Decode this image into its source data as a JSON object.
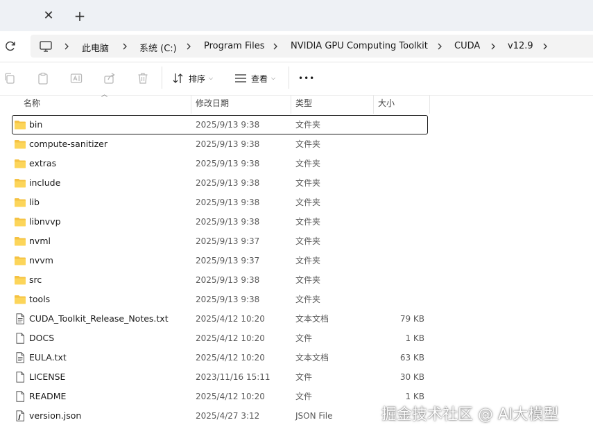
{
  "breadcrumb": [
    "此电脑",
    "系统 (C:)",
    "Program Files",
    "NVIDIA GPU Computing Toolkit",
    "CUDA",
    "v12.9"
  ],
  "toolbar": {
    "sort_label": "排序",
    "view_label": "查看",
    "more_label": "•••"
  },
  "columns": {
    "name": "名称",
    "date": "修改日期",
    "type": "类型",
    "size": "大小"
  },
  "files": [
    {
      "name": "bin",
      "date": "2025/9/13 9:38",
      "type": "文件夹",
      "size": "",
      "icon": "folder-icon",
      "selected": true
    },
    {
      "name": "compute-sanitizer",
      "date": "2025/9/13 9:38",
      "type": "文件夹",
      "size": "",
      "icon": "folder-icon"
    },
    {
      "name": "extras",
      "date": "2025/9/13 9:38",
      "type": "文件夹",
      "size": "",
      "icon": "folder-icon"
    },
    {
      "name": "include",
      "date": "2025/9/13 9:38",
      "type": "文件夹",
      "size": "",
      "icon": "folder-icon"
    },
    {
      "name": "lib",
      "date": "2025/9/13 9:38",
      "type": "文件夹",
      "size": "",
      "icon": "folder-icon"
    },
    {
      "name": "libnvvp",
      "date": "2025/9/13 9:38",
      "type": "文件夹",
      "size": "",
      "icon": "folder-icon"
    },
    {
      "name": "nvml",
      "date": "2025/9/13 9:37",
      "type": "文件夹",
      "size": "",
      "icon": "folder-icon"
    },
    {
      "name": "nvvm",
      "date": "2025/9/13 9:37",
      "type": "文件夹",
      "size": "",
      "icon": "folder-icon"
    },
    {
      "name": "src",
      "date": "2025/9/13 9:38",
      "type": "文件夹",
      "size": "",
      "icon": "folder-icon"
    },
    {
      "name": "tools",
      "date": "2025/9/13 9:38",
      "type": "文件夹",
      "size": "",
      "icon": "folder-icon"
    },
    {
      "name": "CUDA_Toolkit_Release_Notes.txt",
      "date": "2025/4/12 10:20",
      "type": "文本文档",
      "size": "79 KB",
      "icon": "text-file-icon"
    },
    {
      "name": "DOCS",
      "date": "2025/4/12 10:20",
      "type": "文件",
      "size": "1 KB",
      "icon": "file-icon"
    },
    {
      "name": "EULA.txt",
      "date": "2025/4/12 10:20",
      "type": "文本文档",
      "size": "63 KB",
      "icon": "text-file-icon"
    },
    {
      "name": "LICENSE",
      "date": "2023/11/16 15:11",
      "type": "文件",
      "size": "30 KB",
      "icon": "file-icon"
    },
    {
      "name": "README",
      "date": "2025/4/12 10:20",
      "type": "文件",
      "size": "1 KB",
      "icon": "file-icon"
    },
    {
      "name": "version.json",
      "date": "2025/4/27 3:12",
      "type": "JSON File",
      "size": "",
      "icon": "json-file-icon"
    }
  ],
  "watermark": "掘金技术社区 @ AI大模型",
  "colors": {
    "folder": "#f5c243",
    "tabbar_bg": "#eef1f5",
    "address_bg": "#f3f3f3"
  }
}
